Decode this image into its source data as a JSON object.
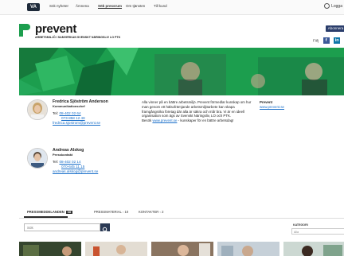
{
  "topbar": {
    "logo": "VA",
    "links": [
      "Sök nyheter",
      "Ämnena",
      "Sök pressrum",
      "Om tjänsten",
      "Till kund"
    ],
    "active_index": 2,
    "login": "Logga"
  },
  "brand": {
    "name": "prevent",
    "subtitle": "ARBETSMILJÖ I SAMVERKAN SVENSKT NÄRINGSLIV LO PTK",
    "follow": "Abonnera",
    "follow_label": "Följ",
    "social": [
      "f",
      "in",
      "t"
    ]
  },
  "colors": {
    "brand_green": "#1c9e4e",
    "link": "#1a6fc9",
    "navy": "#2a3d6b"
  },
  "contacts": [
    {
      "name": "Fredrica Sjöström Anderson",
      "role": "Kommunikationschef",
      "tel_label": "Tel:",
      "phone1": "08-402 02 64",
      "phone2": "073-858 12 48",
      "email": "fredrica.sjostrom@prevent.se"
    },
    {
      "name": "Andreas Alskog",
      "role": "Presskontakt",
      "tel_label": "Tel:",
      "phone1": "08-402 02 14",
      "phone2": "070-645 11 15",
      "email": "andreas.alskog@prevent.se"
    }
  ],
  "about": {
    "text": "Alla vinner på en bättre arbetsmiljö. Prevent förmedlar kunskap om hur man genom ett hälsofrämjande arbetsmiljöarbete kan skapa framgångsrika företag där alla är säkra och mår bra. Vi är en ideell organisation som ägs av Svenskt Näringsliv, LO och PTK.",
    "visit_prefix": "Besök",
    "visit_link": "www.prevent.se",
    "visit_suffix": "- kunskaper för en bättre arbetsdag!"
  },
  "side": {
    "title": "Prevent",
    "link": "www.prevent.se"
  },
  "tabs": [
    {
      "label": "PRESSMEDDELANDEN",
      "count": "68"
    },
    {
      "label": "PRESSMATERIAL",
      "count": "10"
    },
    {
      "label": "KONTAKTER",
      "count": "2"
    }
  ],
  "search": {
    "placeholder": "Sök"
  },
  "category": {
    "label": "KATEGORI",
    "value": "Alla"
  }
}
